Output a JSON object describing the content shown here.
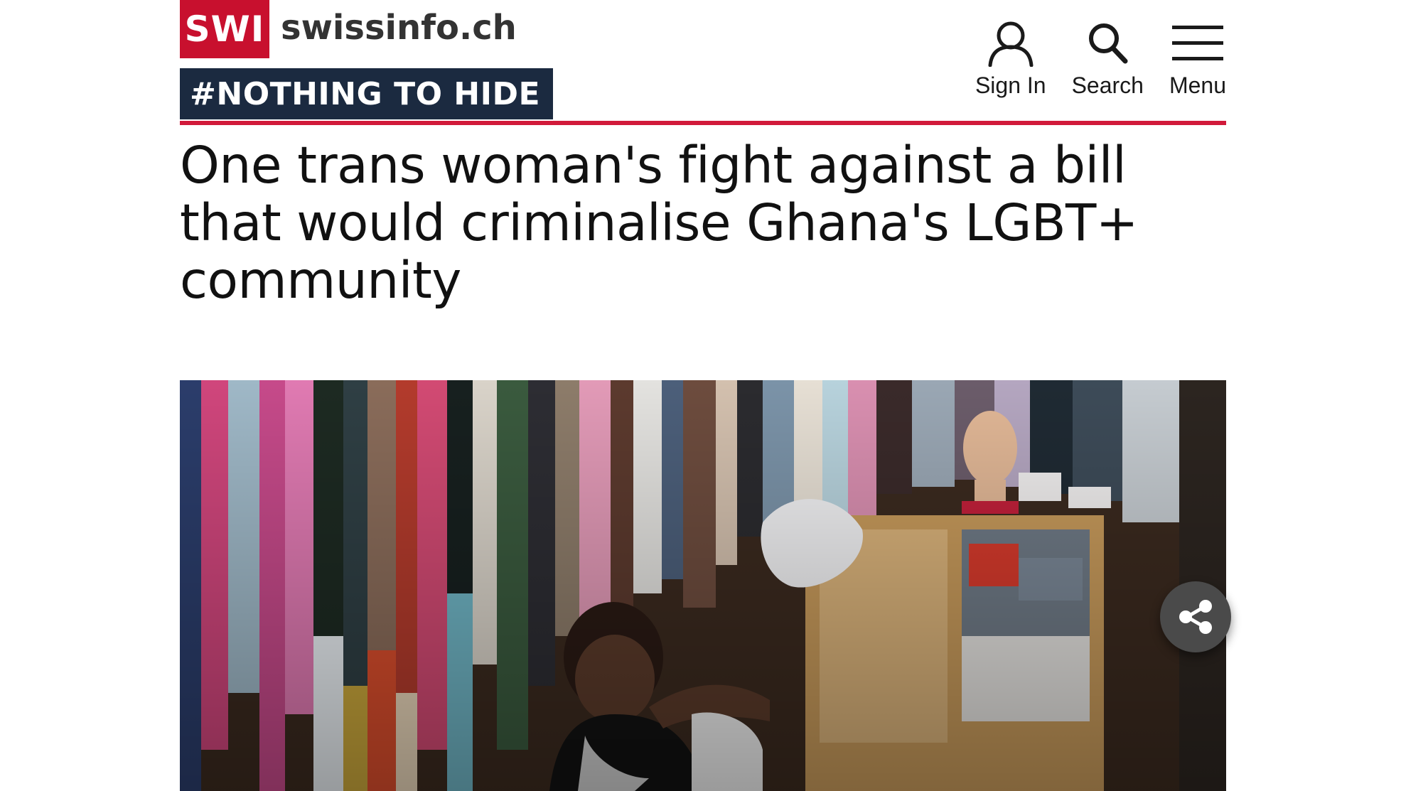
{
  "header": {
    "logo_badge": "SWI",
    "site_name": "swissinfo.ch",
    "campaign_tag": "#NOTHING TO HIDE",
    "brand_red": "#c8102e",
    "campaign_bg": "#1b2a40"
  },
  "nav": {
    "sign_in_label": "Sign In",
    "search_label": "Search",
    "menu_label": "Menu",
    "icons": [
      "user-icon",
      "search-icon",
      "hamburger-menu-icon"
    ]
  },
  "article": {
    "headline": "One trans woman's fight against a bill that would criminalise Ghana's LGBT+ community"
  },
  "share": {
    "icon": "share-icon"
  }
}
